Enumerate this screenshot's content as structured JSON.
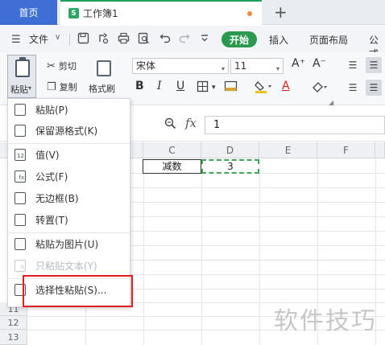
{
  "tabs": {
    "home": "首页",
    "doc_icon": "S",
    "doc_title": "工作簿1",
    "new_tab": "+"
  },
  "menu": {
    "hamburger": "☰",
    "file": "文件",
    "file_caret": "∨",
    "quick_icons": [
      "save-icon",
      "export-icon",
      "print-icon",
      "preview-icon",
      "undo-icon",
      "redo-icon",
      "more-icon"
    ],
    "start": "开始",
    "items": [
      "插入",
      "页面布局",
      "公式"
    ]
  },
  "ribbon": {
    "paste": "粘贴",
    "paste_caret": "▾",
    "cut": "剪切",
    "copy": "复制",
    "format_painter": "格式刷",
    "font_name": "宋体",
    "font_size": "11",
    "grow_font": "A⁺",
    "shrink_font": "A⁻",
    "bold": "B",
    "italic": "I",
    "underline": "U",
    "border_caret": "▾",
    "font_color": "A"
  },
  "formula": {
    "fx": "fx",
    "value": "1"
  },
  "grid": {
    "columns": [
      "C",
      "D",
      "E",
      "F"
    ],
    "rows": [
      "11",
      "12",
      "13"
    ],
    "cell_c2": "减数",
    "cell_d2": "3"
  },
  "paste_menu": {
    "items": [
      {
        "label": "粘贴(P)",
        "badge": ""
      },
      {
        "label": "保留源格式(K)",
        "badge": ""
      },
      {
        "label": "值(V)",
        "badge": "12"
      },
      {
        "label": "公式(F)",
        "badge": "fx"
      },
      {
        "label": "无边框(B)",
        "badge": ""
      },
      {
        "label": "转置(T)",
        "badge": ""
      },
      {
        "label": "粘贴为图片(U)",
        "badge": ""
      },
      {
        "label": "只粘贴文本(Y)",
        "badge": "A"
      },
      {
        "label": "选择性粘贴(S)...",
        "badge": ""
      }
    ]
  },
  "watermark": "软件技巧",
  "colors": {
    "home_tab": "#3f6fd4",
    "start_pill": "#2b9a4f",
    "highlight_box": "#e02020",
    "copy_marquee": "#3fa65a"
  }
}
